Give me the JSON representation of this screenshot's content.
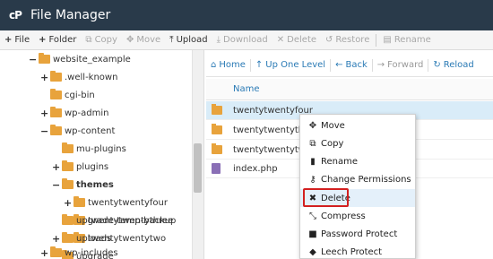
{
  "header": {
    "logo_text": "cP",
    "title": "File Manager"
  },
  "toolbar": {
    "file": {
      "label": "File",
      "icon": "plus-icon"
    },
    "folder": {
      "label": "Folder",
      "icon": "plus-icon"
    },
    "copy": {
      "label": "Copy",
      "icon": "copy-icon"
    },
    "move": {
      "label": "Move",
      "icon": "move-icon"
    },
    "upload": {
      "label": "Upload",
      "icon": "upload-icon"
    },
    "download": {
      "label": "Download",
      "icon": "download-icon"
    },
    "delete": {
      "label": "Delete",
      "icon": "x-icon"
    },
    "restore": {
      "label": "Restore",
      "icon": "undo-icon"
    },
    "rename": {
      "label": "Rename",
      "icon": "document-icon"
    }
  },
  "tree": {
    "items": [
      {
        "label": "website_example",
        "toggle": "−"
      },
      {
        "label": ".well-known",
        "toggle": "+"
      },
      {
        "label": "cgi-bin",
        "toggle": ""
      },
      {
        "label": "wp-admin",
        "toggle": "+"
      },
      {
        "label": "wp-content",
        "toggle": "−"
      },
      {
        "label": "mu-plugins",
        "toggle": ""
      },
      {
        "label": "plugins",
        "toggle": "+"
      },
      {
        "label": "themes",
        "toggle": "−"
      },
      {
        "label": "twentytwentyfour",
        "toggle": "+"
      },
      {
        "label": "twentytwentythree",
        "toggle": "+"
      },
      {
        "label": "twentytwentytwo",
        "toggle": "+"
      },
      {
        "label": "upgrade",
        "toggle": ""
      },
      {
        "label": "upgrade-temp-backup",
        "toggle": ""
      },
      {
        "label": "uploads",
        "toggle": "+"
      },
      {
        "label": "wp-includes",
        "toggle": "+"
      }
    ]
  },
  "nav": {
    "home": "Home",
    "up_one_level": "Up One Level",
    "back": "Back",
    "forward": "Forward",
    "reload": "Reload"
  },
  "list": {
    "column_name": "Name",
    "files": [
      {
        "name": "twentytwentyfour",
        "type": "folder"
      },
      {
        "name": "twentytwentythree",
        "type": "folder"
      },
      {
        "name": "twentytwentytwo",
        "type": "folder"
      },
      {
        "name": "index.php",
        "type": "php"
      }
    ]
  },
  "context_menu": {
    "items": [
      {
        "label": "Move",
        "icon": "move-icon"
      },
      {
        "label": "Copy",
        "icon": "copy-icon"
      },
      {
        "label": "Rename",
        "icon": "document-icon"
      },
      {
        "label": "Change Permissions",
        "icon": "key-icon"
      },
      {
        "label": "Delete",
        "icon": "x-icon"
      },
      {
        "label": "Compress",
        "icon": "compress-icon"
      },
      {
        "label": "Password Protect",
        "icon": "lock-icon"
      },
      {
        "label": "Leech Protect",
        "icon": "shield-icon"
      }
    ]
  },
  "colors": {
    "header_bg": "#293a4a",
    "link_blue": "#2a7ab5",
    "folder_orange": "#e8a33c",
    "highlight_red": "#d32020",
    "selected_row": "#d9ecf8"
  }
}
